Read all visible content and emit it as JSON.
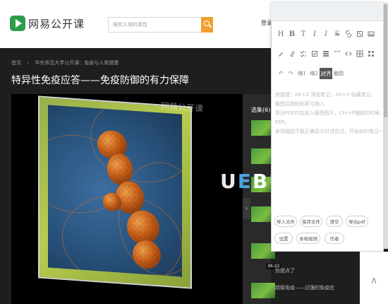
{
  "header": {
    "brand": "网易公开课",
    "search_placeholder": "探究人体的本性",
    "login": "登录"
  },
  "breadcrumb": [
    "首页",
    "›",
    "华东师范大学公开课：免疫与人类健康"
  ],
  "page_title": "特异性免疫应答——免疫防御的有力保障",
  "video": {
    "watermark": "网易公开课"
  },
  "playlist": {
    "label": "选集(6)",
    "collapse": "›",
    "durations": [
      "36:22"
    ],
    "items": [
      "别提点了",
      "超级免疫——过强的免疫应"
    ]
  },
  "overlay_logo": {
    "u": "U",
    "e": "E",
    "rest": "BU"
  },
  "editor": {
    "toolbar_row1": [
      "H",
      "B",
      "T",
      "I",
      "I",
      "S",
      "",
      "",
      ""
    ],
    "toolbar_row2": [
      "",
      "",
      "",
      "",
      "",
      "“”",
      "",
      "",
      ""
    ],
    "toolbar_row3": [
      "↶",
      "↷",
      "缩1",
      "缩2",
      "对齐",
      "截图"
    ],
    "active_tool": "对齐",
    "content_lines": [
      "快捷键：Alt+Z 添加笔记，Alt+X 隐藏笔记，",
      "截图后按粘贴即可插入",
      "导出PDF时会放入截图图片，Ctrl+P播放的时候，添加为",
      "PDF。",
      "发现截图不能正确显示时请尝试，开始你的笔记~"
    ],
    "buttons_row1": [
      "导入文件",
      "保存文件",
      "清空",
      "导出pdf"
    ],
    "buttons_row2": [
      "设置",
      "本地视频",
      "作者"
    ]
  },
  "back_to_top": "∧",
  "colors": {
    "logo_green": "#2e9d4a",
    "search_orange": "#f0a02e",
    "page_bg": "#1e1e1e",
    "active_tool": "#555555"
  }
}
